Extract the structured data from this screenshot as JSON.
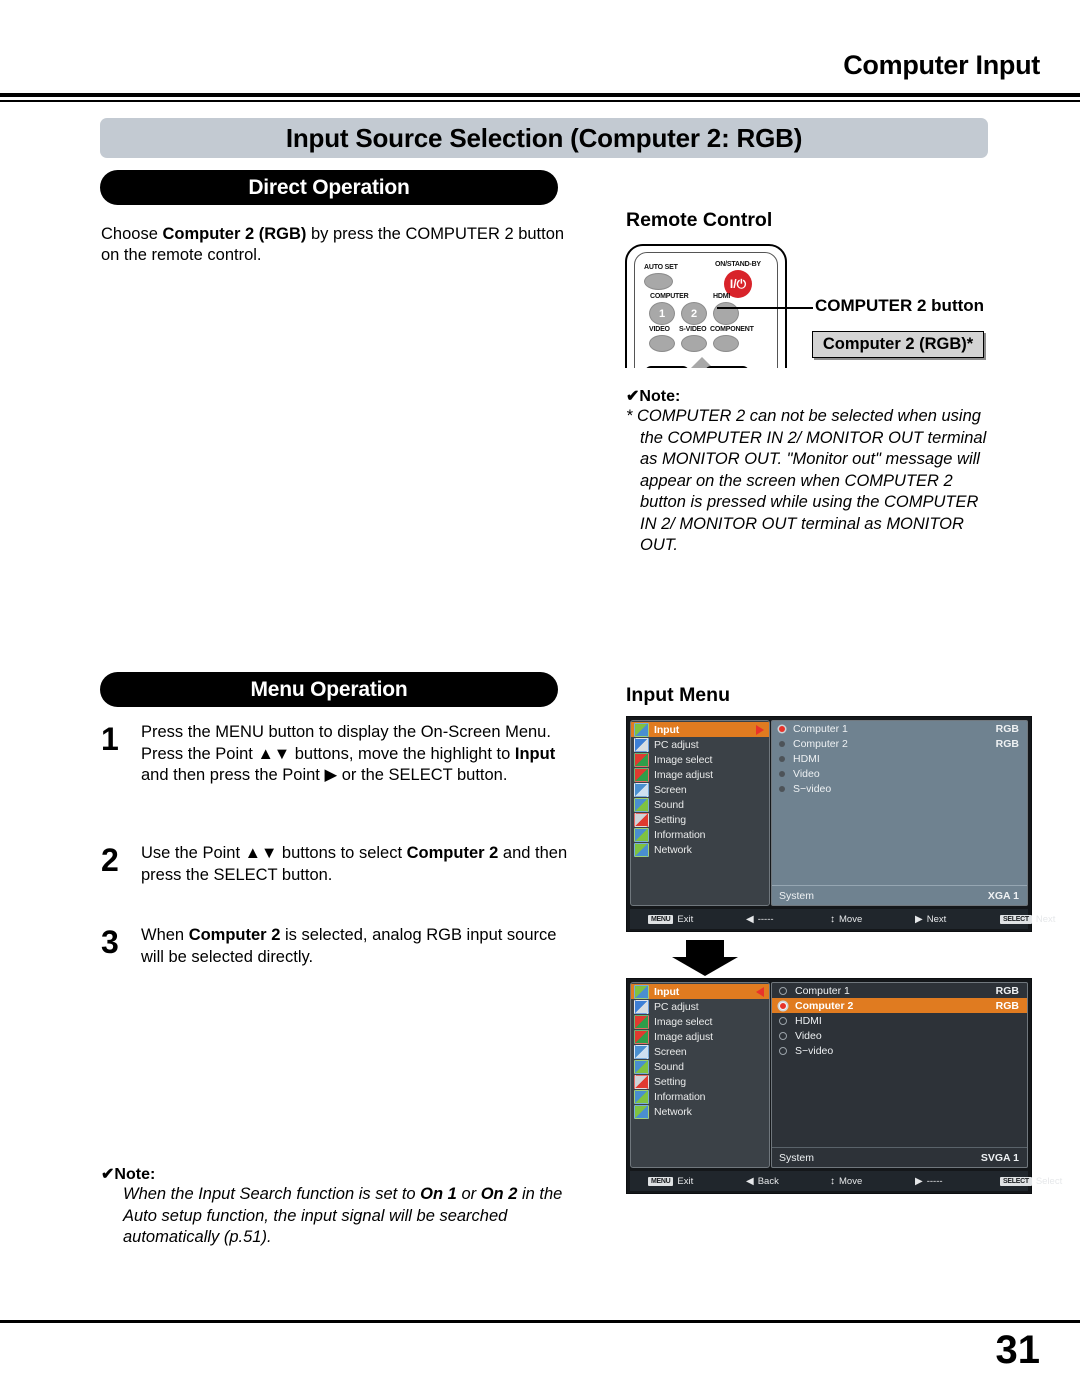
{
  "header": {
    "running_title": "Computer Input"
  },
  "section": {
    "title": "Input Source Selection (Computer 2: RGB)"
  },
  "direct_operation": {
    "heading": "Direct Operation",
    "description_pre": "Choose ",
    "description_bold": "Computer 2 (RGB)",
    "description_post": " by press the COMPUTER 2 button on the remote control."
  },
  "remote": {
    "heading": "Remote Control",
    "labels": {
      "auto_set": "AUTO SET",
      "on_standby": "ON/STAND-BY",
      "power_glyph": "I/⏻",
      "computer": "COMPUTER",
      "hdmi": "HDMI",
      "video": "VIDEO",
      "s_video": "S-VIDEO",
      "component": "COMPONENT",
      "btn_1": "1",
      "btn_2": "2"
    },
    "callout_label": "COMPUTER 2 button",
    "callout_box": "Computer 2 (RGB)*"
  },
  "note_remote": {
    "heading": "✔Note:",
    "text": "* COMPUTER 2 can not be selected when using the COMPUTER IN 2/ MONITOR OUT terminal as MONITOR OUT. \"Monitor out\" message will appear on the screen when COMPUTER 2 button is pressed while using the COMPUTER IN 2/ MONITOR OUT terminal as MONITOR OUT."
  },
  "menu_operation": {
    "heading": "Menu Operation",
    "steps": [
      {
        "num": "1",
        "parts": [
          {
            "t": "Press the MENU button to display the On-Screen Menu. Press the Point ▲▼ buttons, move the highlight to ",
            "bold": false
          },
          {
            "t": "Input",
            "bold": true
          },
          {
            "t": " and then press the Point ▶ or the SELECT button.",
            "bold": false
          }
        ]
      },
      {
        "num": "2",
        "parts": [
          {
            "t": "Use the Point ▲▼ buttons to select ",
            "bold": false
          },
          {
            "t": "Computer 2",
            "bold": true
          },
          {
            "t": " and then press the SELECT button.",
            "bold": false
          }
        ]
      },
      {
        "num": "3",
        "parts": [
          {
            "t": "When ",
            "bold": false
          },
          {
            "t": "Computer 2",
            "bold": true
          },
          {
            "t": " is selected, analog RGB input source will be selected directly.",
            "bold": false
          }
        ]
      }
    ]
  },
  "input_menu": {
    "heading": "Input Menu",
    "sidebar_items": [
      {
        "label": "Input",
        "icon": "input-icon"
      },
      {
        "label": "PC adjust",
        "icon": "pc-adjust-icon"
      },
      {
        "label": "Image select",
        "icon": "image-select-icon"
      },
      {
        "label": "Image adjust",
        "icon": "image-adjust-icon"
      },
      {
        "label": "Screen",
        "icon": "screen-icon"
      },
      {
        "label": "Sound",
        "icon": "sound-icon"
      },
      {
        "label": "Setting",
        "icon": "setting-icon"
      },
      {
        "label": "Information",
        "icon": "information-icon"
      },
      {
        "label": "Network",
        "icon": "network-icon"
      }
    ],
    "osd_1": {
      "selected_sidebar": "Input",
      "arrow": "right",
      "sources": [
        {
          "name": "Computer 1",
          "value": "RGB",
          "selected": true,
          "highlighted": false
        },
        {
          "name": "Computer 2",
          "value": "RGB",
          "selected": false,
          "highlighted": false
        },
        {
          "name": "HDMI",
          "value": "",
          "selected": false,
          "highlighted": false
        },
        {
          "name": "Video",
          "value": "",
          "selected": false,
          "highlighted": false
        },
        {
          "name": "S−video",
          "value": "",
          "selected": false,
          "highlighted": false
        }
      ],
      "system_label": "System",
      "system_value": "XGA 1",
      "bottom_bar": [
        {
          "key": "MENU",
          "text": "Exit"
        },
        {
          "glyph": "◀",
          "text": "-----"
        },
        {
          "glyph": "↕",
          "text": "Move"
        },
        {
          "glyph": "▶",
          "text": "Next"
        },
        {
          "key": "SELECT",
          "text": "Next"
        }
      ]
    },
    "osd_2": {
      "selected_sidebar": "Input",
      "arrow": "left",
      "sources": [
        {
          "name": "Computer 1",
          "value": "RGB",
          "selected": false,
          "highlighted": false
        },
        {
          "name": "Computer 2",
          "value": "RGB",
          "selected": true,
          "highlighted": true
        },
        {
          "name": "HDMI",
          "value": "",
          "selected": false,
          "highlighted": false
        },
        {
          "name": "Video",
          "value": "",
          "selected": false,
          "highlighted": false
        },
        {
          "name": "S−video",
          "value": "",
          "selected": false,
          "highlighted": false
        }
      ],
      "system_label": "System",
      "system_value": "SVGA 1",
      "bottom_bar": [
        {
          "key": "MENU",
          "text": "Exit"
        },
        {
          "glyph": "◀",
          "text": "Back"
        },
        {
          "glyph": "↕",
          "text": "Move"
        },
        {
          "glyph": "▶",
          "text": "-----"
        },
        {
          "key": "SELECT",
          "text": "Select"
        }
      ]
    }
  },
  "note_bottom": {
    "heading": "✔Note:",
    "parts": [
      {
        "t": "When the Input Search function is set to ",
        "bold": false
      },
      {
        "t": "On 1",
        "bold": true
      },
      {
        "t": " or ",
        "bold": false
      },
      {
        "t": "On 2",
        "bold": true
      },
      {
        "t": " in the Auto setup function, the input signal will be searched automatically (p.51).",
        "bold": false
      }
    ]
  },
  "footer": {
    "page_number": "31"
  },
  "colors": {
    "accent_orange": "#e07b20",
    "accent_red": "#e8332a",
    "title_bar": "#c3cad2",
    "osd_panel_inactive": "#6f8290",
    "osd_panel_active": "#2d3238",
    "osd_sidebar": "#3b4147"
  }
}
